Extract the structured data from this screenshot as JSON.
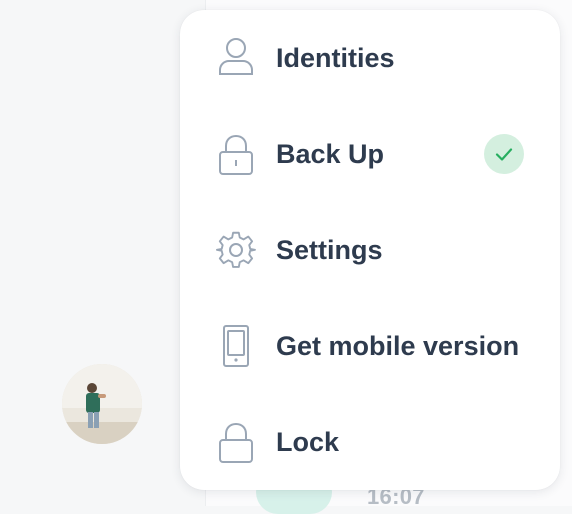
{
  "menu": {
    "items": [
      {
        "id": "identities",
        "label": "Identities",
        "icon": "user-icon"
      },
      {
        "id": "backup",
        "label": "Back Up",
        "icon": "padlock-icon",
        "status": "check-icon"
      },
      {
        "id": "settings",
        "label": "Settings",
        "icon": "gear-icon"
      },
      {
        "id": "mobile",
        "label": "Get mobile version",
        "icon": "mobile-phone-icon"
      },
      {
        "id": "lock",
        "label": "Lock",
        "icon": "lock-icon"
      }
    ]
  },
  "chat": {
    "timestamp": "16:07"
  },
  "colors": {
    "text": "#2e3b4e",
    "icon": "#9aa6b5",
    "check_bg": "#d4efdf",
    "check": "#27ae60",
    "bubble": "#d7f1ea"
  }
}
